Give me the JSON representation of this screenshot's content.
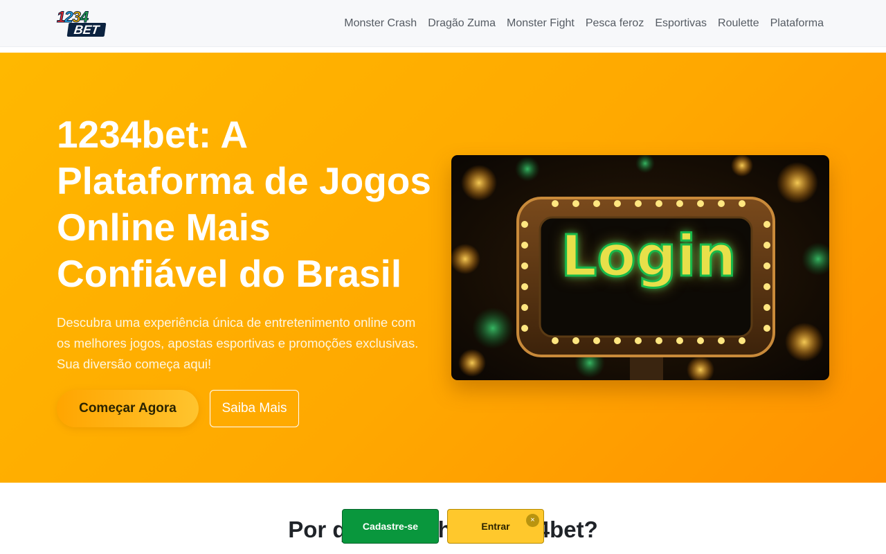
{
  "header": {
    "logo": {
      "digits": [
        "1",
        "2",
        "3",
        "4"
      ],
      "digit_colors": [
        "#e8262b",
        "#20a4e6",
        "#f5b400",
        "#24a84a"
      ],
      "word": "BET"
    },
    "nav": [
      "Monster Crash",
      "Dragão Zuma",
      "Monster Fight",
      "Pesca feroz",
      "Esportivas",
      "Roulette",
      "Plataforma"
    ]
  },
  "hero": {
    "title": "1234bet: A Plataforma de Jogos Online Mais Confiável do Brasil",
    "subtitle": "Descubra uma experiência única de entretenimento online com os melhores jogos, apostas esportivas e promoções exclusivas. Sua diversão começa aqui!",
    "cta_primary": "Começar Agora",
    "cta_secondary": "Saiba Mais",
    "image": {
      "sign_text": "Login"
    }
  },
  "section": {
    "title": "Por que escolher a 1234bet?"
  },
  "floating_bar": {
    "register": "Cadastre-se",
    "login": "Entrar",
    "close": "×"
  },
  "colors": {
    "hero_gradient": [
      "#ffb800",
      "#ff9200"
    ],
    "register_button": "#09973d",
    "login_button": "#ffc82c"
  }
}
